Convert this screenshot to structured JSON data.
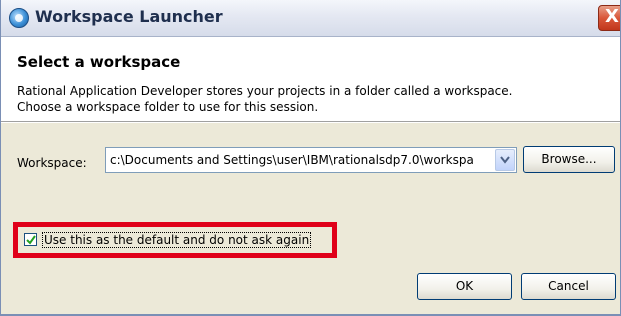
{
  "window": {
    "title": "Workspace Launcher",
    "close_label": "X"
  },
  "header": {
    "title": "Select a workspace",
    "description_line1": "Rational Application Developer stores your projects in a folder called a workspace.",
    "description_line2": "Choose a workspace folder to use for this session."
  },
  "workspace": {
    "label": "Workspace:",
    "value": "c:\\Documents and Settings\\user\\IBM\\rationalsdp7.0\\workspa",
    "browse_label": "Browse..."
  },
  "default_option": {
    "label": "Use this as the default and do not ask again",
    "checked": true
  },
  "buttons": {
    "ok_label": "OK",
    "cancel_label": "Cancel"
  },
  "colors": {
    "highlight": "#e0001a",
    "dialog_bg": "#ece9d8",
    "header_bg": "#ffffff",
    "checkmark": "#21a121"
  },
  "icons": {
    "app": "eclipse-launcher-icon",
    "close": "close-icon",
    "dropdown": "chevron-down-icon",
    "check": "checkmark-icon"
  }
}
